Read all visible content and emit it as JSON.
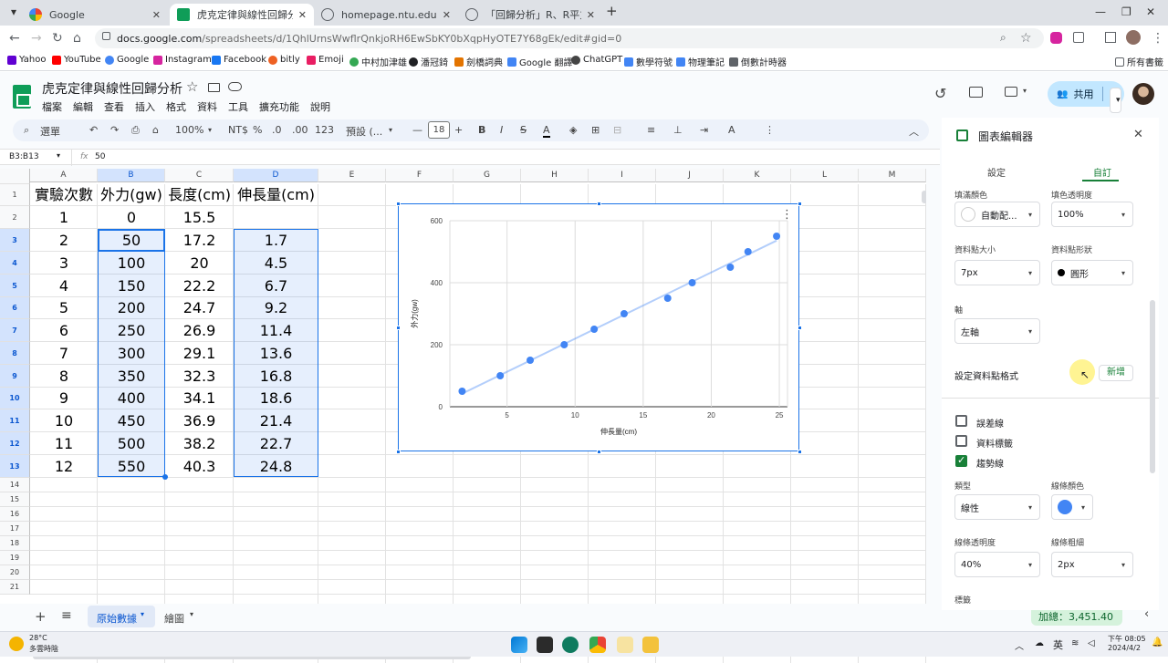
{
  "browser": {
    "tabs": [
      {
        "label": "Google",
        "active": false
      },
      {
        "label": "虎克定律與線性回歸分析 - Goo",
        "active": true
      },
      {
        "label": "homepage.ntu.edu.tw/~clhsi",
        "active": false
      },
      {
        "label": "「回歸分析」R、R平方與調整後",
        "active": false
      }
    ],
    "url_host": "docs.google.com",
    "url_path": "/spreadsheets/d/1QhlUrnsWwflrQnkjoRH6EwSbKY0bXqpHyOTE7Y68gEk/edit#gid=0",
    "bookmarks": [
      "Yahoo",
      "YouTube",
      "Google",
      "Instagram",
      "Facebook",
      "bitly",
      "Emoji",
      "中村加津雄",
      "潘冠錡",
      "劍橋詞典",
      "Google 翻譯",
      "ChatGPT",
      "數學符號",
      "物理筆記",
      "倒數計時器"
    ],
    "all_bookmarks": "所有書籤"
  },
  "sheets": {
    "title": "虎克定律與線性回歸分析",
    "menus": [
      "檔案",
      "編輯",
      "查看",
      "插入",
      "格式",
      "資料",
      "工具",
      "擴充功能",
      "說明"
    ],
    "share_label": "共用",
    "toolbar": {
      "search": "選單",
      "zoom": "100%",
      "currency": "NT$",
      "percent": "%",
      "dec_minus": ".0",
      "dec_plus": ".00",
      "number_fmt": "123",
      "font": "預設 (...",
      "font_size": "18"
    },
    "name_box": "B3:B13",
    "formula_icon": "fx",
    "formula": "50",
    "columns": [
      "A",
      "B",
      "C",
      "D",
      "E",
      "F",
      "G",
      "H",
      "I",
      "J",
      "K",
      "L",
      "M"
    ],
    "rows": [
      "1",
      "2",
      "3",
      "4",
      "5",
      "6",
      "7",
      "8",
      "9",
      "10",
      "11",
      "12",
      "13",
      "14",
      "15",
      "16",
      "17",
      "18",
      "19",
      "20",
      "21"
    ],
    "headers": [
      "實驗次數",
      "外力(gw)",
      "長度(cm)",
      "伸長量(cm)"
    ],
    "table": [
      [
        "1",
        "0",
        "15.5",
        ""
      ],
      [
        "2",
        "50",
        "17.2",
        "1.7"
      ],
      [
        "3",
        "100",
        "20",
        "4.5"
      ],
      [
        "4",
        "150",
        "22.2",
        "6.7"
      ],
      [
        "5",
        "200",
        "24.7",
        "9.2"
      ],
      [
        "6",
        "250",
        "26.9",
        "11.4"
      ],
      [
        "7",
        "300",
        "29.1",
        "13.6"
      ],
      [
        "8",
        "350",
        "32.3",
        "16.8"
      ],
      [
        "9",
        "400",
        "34.1",
        "18.6"
      ],
      [
        "10",
        "450",
        "36.9",
        "21.4"
      ],
      [
        "11",
        "500",
        "38.2",
        "22.7"
      ],
      [
        "12",
        "550",
        "40.3",
        "24.8"
      ]
    ],
    "sheet_tabs": [
      "原始數據",
      "繪圖"
    ],
    "sum_label": "加總：3,451.40"
  },
  "chart_data": {
    "type": "scatter",
    "xlabel": "伸長量(cm)",
    "ylabel": "外力(gw)",
    "x_ticks": [
      "5",
      "10",
      "15",
      "20",
      "25"
    ],
    "y_ticks": [
      "0",
      "200",
      "400",
      "600"
    ],
    "xlim": [
      0.8,
      25.6
    ],
    "ylim": [
      0,
      600
    ],
    "points": [
      [
        1.7,
        50
      ],
      [
        4.5,
        100
      ],
      [
        6.7,
        150
      ],
      [
        9.2,
        200
      ],
      [
        11.4,
        250
      ],
      [
        13.6,
        300
      ],
      [
        16.8,
        350
      ],
      [
        18.6,
        400
      ],
      [
        21.4,
        450
      ],
      [
        22.7,
        500
      ],
      [
        24.8,
        550
      ]
    ],
    "trendline": true,
    "grid": true,
    "point_color": "#4285f4"
  },
  "chart_editor": {
    "title": "圖表編輯器",
    "tabs": [
      "設定",
      "自訂"
    ],
    "fill_color_label": "填滿顏色",
    "fill_color_value": "自動配...",
    "fill_opacity_label": "填色透明度",
    "fill_opacity_value": "100%",
    "point_size_label": "資料點大小",
    "point_size_value": "7px",
    "point_shape_label": "資料點形狀",
    "point_shape_value": "圓形",
    "axis_label": "軸",
    "axis_value": "左軸",
    "format_point_label": "設定資料點格式",
    "add_button": "新增",
    "error_bars": "誤差線",
    "data_labels": "資料標籤",
    "trendline": "趨勢線",
    "type_label": "類型",
    "type_value": "線性",
    "line_color_label": "線條顏色",
    "line_opacity_label": "線條透明度",
    "line_opacity_value": "40%",
    "line_thickness_label": "線條粗細",
    "line_thickness_value": "2px",
    "label_label": "標籤"
  },
  "taskbar": {
    "weather_temp": "28°C",
    "weather_desc": "多雲時陰",
    "ime": "英",
    "time": "下午 08:05",
    "date": "2024/4/2"
  }
}
